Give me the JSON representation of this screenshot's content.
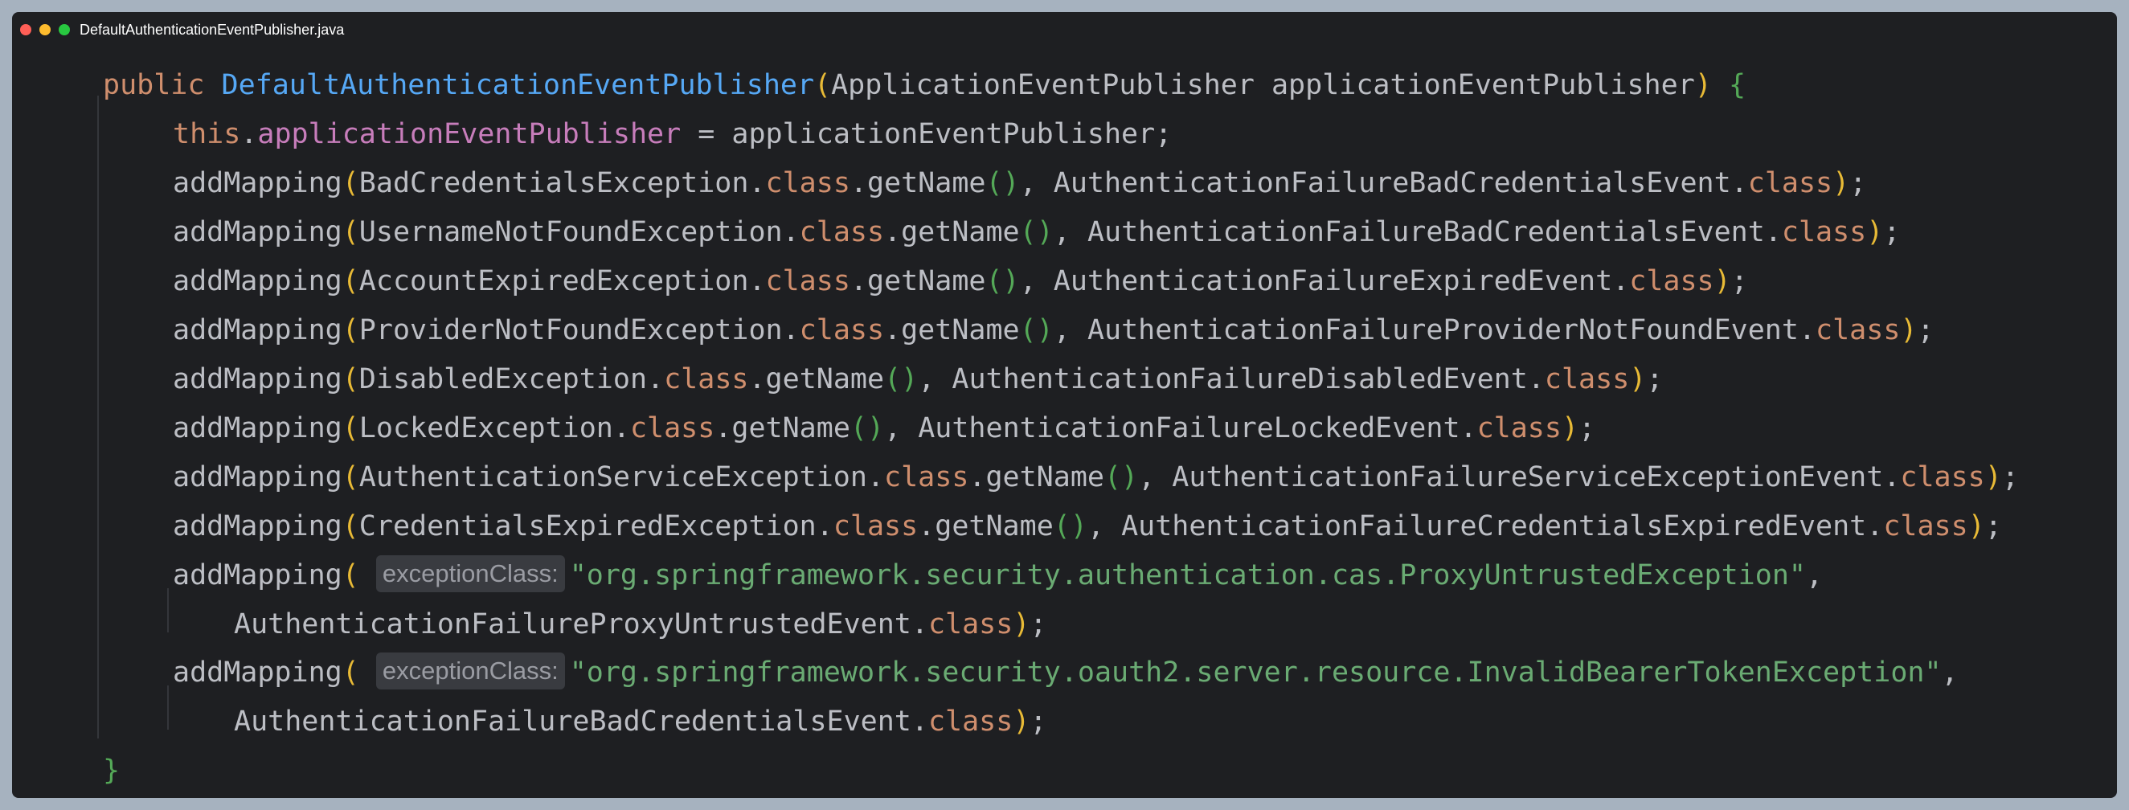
{
  "window": {
    "title": "DefaultAuthenticationEventPublisher.java"
  },
  "code": {
    "line1": {
      "kw_public": "public",
      "constructor_name": "DefaultAuthenticationEventPublisher",
      "open_paren": "(",
      "param_type": "ApplicationEventPublisher",
      "param_name": " applicationEventPublisher",
      "close_paren": ")",
      "open_brace": "{"
    },
    "line2": {
      "kw_this": "this",
      "dot": ".",
      "field": "applicationEventPublisher",
      "rest": " = applicationEventPublisher;"
    },
    "mappings": [
      {
        "method": "addMapping",
        "exception": "BadCredentialsException",
        "event": "AuthenticationFailureBadCredentialsEvent"
      },
      {
        "method": "addMapping",
        "exception": "UsernameNotFoundException",
        "event": "AuthenticationFailureBadCredentialsEvent"
      },
      {
        "method": "addMapping",
        "exception": "AccountExpiredException",
        "event": "AuthenticationFailureExpiredEvent"
      },
      {
        "method": "addMapping",
        "exception": "ProviderNotFoundException",
        "event": "AuthenticationFailureProviderNotFoundEvent"
      },
      {
        "method": "addMapping",
        "exception": "DisabledException",
        "event": "AuthenticationFailureDisabledEvent"
      },
      {
        "method": "addMapping",
        "exception": "LockedException",
        "event": "AuthenticationFailureLockedEvent"
      },
      {
        "method": "addMapping",
        "exception": "AuthenticationServiceException",
        "event": "AuthenticationFailureServiceExceptionEvent"
      },
      {
        "method": "addMapping",
        "exception": "CredentialsExpiredException",
        "event": "AuthenticationFailureCredentialsExpiredEvent"
      }
    ],
    "string_mappings": [
      {
        "method": "addMapping",
        "hint": "exceptionClass:",
        "string": "\"org.springframework.security.authentication.cas.ProxyUntrustedException\"",
        "event": "AuthenticationFailureProxyUntrustedEvent"
      },
      {
        "method": "addMapping",
        "hint": "exceptionClass:",
        "string": "\"org.springframework.security.oauth2.server.resource.InvalidBearerTokenException\"",
        "event": "AuthenticationFailureBadCredentialsEvent"
      }
    ],
    "tokens": {
      "kw_class": "class",
      "dot": ".",
      "get_name": "getName",
      "open_paren": "(",
      "close_paren": ")",
      "empty_parens": "()",
      "comma": ",",
      "comma_space": ", ",
      "semicolon": ";"
    },
    "closing_brace": "}"
  }
}
